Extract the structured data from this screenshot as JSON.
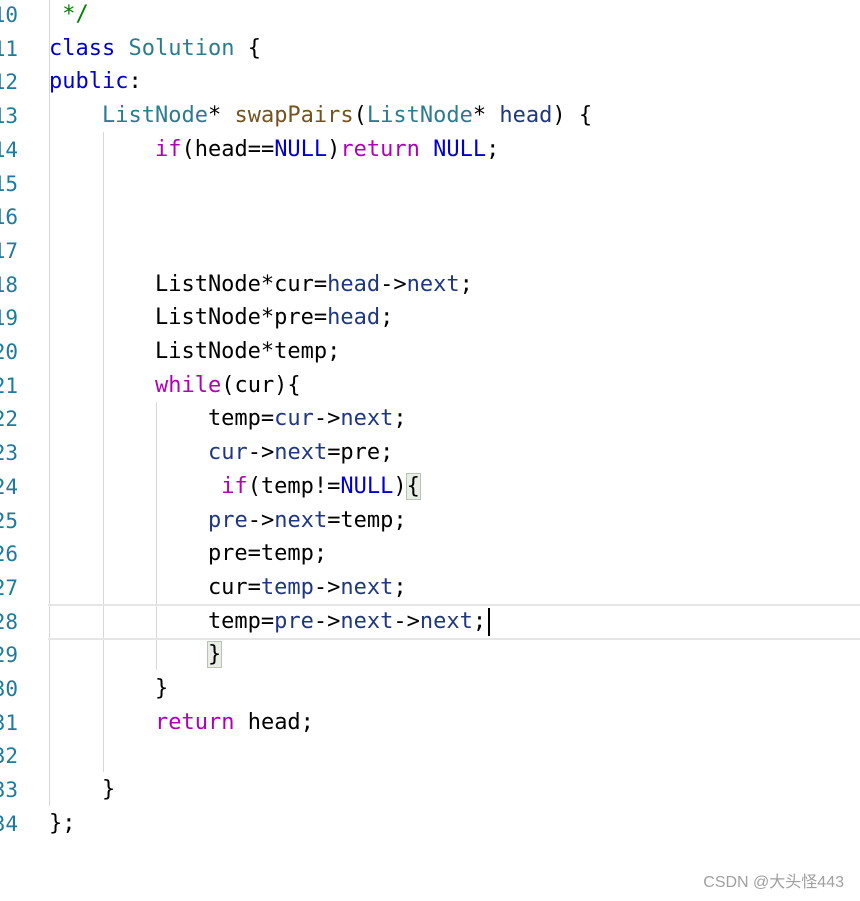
{
  "editor": {
    "language": "C++",
    "lines": [
      {
        "n": "10",
        "tokens": [
          {
            "t": " */",
            "c": "cm"
          }
        ]
      },
      {
        "n": "11",
        "tokens": [
          {
            "t": "class",
            "c": "kw"
          },
          {
            "t": " ",
            "c": "plain"
          },
          {
            "t": "Solution",
            "c": "ty"
          },
          {
            "t": " {",
            "c": "plain"
          }
        ]
      },
      {
        "n": "12",
        "tokens": [
          {
            "t": "public",
            "c": "kw"
          },
          {
            "t": ":",
            "c": "plain"
          }
        ]
      },
      {
        "n": "13",
        "tokens": [
          {
            "t": "    ",
            "c": "plain"
          },
          {
            "t": "ListNode",
            "c": "ty"
          },
          {
            "t": "* ",
            "c": "plain"
          },
          {
            "t": "swapPairs",
            "c": "fn"
          },
          {
            "t": "(",
            "c": "plain"
          },
          {
            "t": "ListNode",
            "c": "ty"
          },
          {
            "t": "* ",
            "c": "plain"
          },
          {
            "t": "head",
            "c": "var"
          },
          {
            "t": ") {",
            "c": "plain"
          }
        ]
      },
      {
        "n": "14",
        "tokens": [
          {
            "t": "        ",
            "c": "plain"
          },
          {
            "t": "if",
            "c": "kw2"
          },
          {
            "t": "(head==",
            "c": "plain"
          },
          {
            "t": "NULL",
            "c": "kw"
          },
          {
            "t": ")",
            "c": "plain"
          },
          {
            "t": "return",
            "c": "kw2"
          },
          {
            "t": " ",
            "c": "plain"
          },
          {
            "t": "NULL",
            "c": "kw"
          },
          {
            "t": ";",
            "c": "plain"
          }
        ]
      },
      {
        "n": "15",
        "tokens": []
      },
      {
        "n": "16",
        "tokens": []
      },
      {
        "n": "17",
        "tokens": []
      },
      {
        "n": "18",
        "tokens": [
          {
            "t": "        ListNode*cur=",
            "c": "plain"
          },
          {
            "t": "head",
            "c": "var"
          },
          {
            "t": "->",
            "c": "plain"
          },
          {
            "t": "next",
            "c": "var"
          },
          {
            "t": ";",
            "c": "plain"
          }
        ]
      },
      {
        "n": "19",
        "tokens": [
          {
            "t": "        ListNode*pre=",
            "c": "plain"
          },
          {
            "t": "head",
            "c": "var"
          },
          {
            "t": ";",
            "c": "plain"
          }
        ]
      },
      {
        "n": "20",
        "tokens": [
          {
            "t": "        ListNode*temp;",
            "c": "plain"
          }
        ]
      },
      {
        "n": "21",
        "tokens": [
          {
            "t": "        ",
            "c": "plain"
          },
          {
            "t": "while",
            "c": "kw2"
          },
          {
            "t": "(cur){",
            "c": "plain"
          }
        ]
      },
      {
        "n": "22",
        "tokens": [
          {
            "t": "            temp=",
            "c": "plain"
          },
          {
            "t": "cur",
            "c": "var"
          },
          {
            "t": "->",
            "c": "plain"
          },
          {
            "t": "next",
            "c": "var"
          },
          {
            "t": ";",
            "c": "plain"
          }
        ]
      },
      {
        "n": "23",
        "tokens": [
          {
            "t": "            ",
            "c": "plain"
          },
          {
            "t": "cur",
            "c": "var"
          },
          {
            "t": "->",
            "c": "plain"
          },
          {
            "t": "next",
            "c": "var"
          },
          {
            "t": "=pre;",
            "c": "plain"
          }
        ]
      },
      {
        "n": "24",
        "tokens": [
          {
            "t": "             ",
            "c": "plain"
          },
          {
            "t": "if",
            "c": "kw2"
          },
          {
            "t": "(temp!=",
            "c": "plain"
          },
          {
            "t": "NULL",
            "c": "kw"
          },
          {
            "t": ")",
            "c": "plain"
          },
          {
            "t": "{",
            "c": "match"
          }
        ]
      },
      {
        "n": "25",
        "tokens": [
          {
            "t": "            ",
            "c": "plain"
          },
          {
            "t": "pre",
            "c": "var"
          },
          {
            "t": "->",
            "c": "plain"
          },
          {
            "t": "next",
            "c": "var"
          },
          {
            "t": "=temp;",
            "c": "plain"
          }
        ]
      },
      {
        "n": "26",
        "tokens": [
          {
            "t": "            pre=temp;",
            "c": "plain"
          }
        ]
      },
      {
        "n": "27",
        "tokens": [
          {
            "t": "            cur=",
            "c": "plain"
          },
          {
            "t": "temp",
            "c": "var"
          },
          {
            "t": "->",
            "c": "plain"
          },
          {
            "t": "next",
            "c": "var"
          },
          {
            "t": ";",
            "c": "plain"
          }
        ]
      },
      {
        "n": "28",
        "tokens": [
          {
            "t": "            temp=",
            "c": "plain"
          },
          {
            "t": "pre",
            "c": "var"
          },
          {
            "t": "->",
            "c": "plain"
          },
          {
            "t": "next",
            "c": "var"
          },
          {
            "t": "->",
            "c": "plain"
          },
          {
            "t": "next",
            "c": "var"
          },
          {
            "t": ";",
            "c": "plain"
          }
        ],
        "caret": true
      },
      {
        "n": "29",
        "tokens": [
          {
            "t": "            ",
            "c": "plain"
          },
          {
            "t": "}",
            "c": "match"
          }
        ]
      },
      {
        "n": "30",
        "tokens": [
          {
            "t": "        }",
            "c": "plain"
          }
        ]
      },
      {
        "n": "31",
        "tokens": [
          {
            "t": "        ",
            "c": "plain"
          },
          {
            "t": "return",
            "c": "kw2"
          },
          {
            "t": " head;",
            "c": "plain"
          }
        ]
      },
      {
        "n": "32",
        "tokens": []
      },
      {
        "n": "33",
        "tokens": [
          {
            "t": "    }",
            "c": "plain"
          }
        ]
      },
      {
        "n": "34",
        "tokens": [
          {
            "t": "};",
            "c": "plain"
          }
        ]
      }
    ]
  },
  "watermark": "CSDN @大头怪443",
  "colors": {
    "keyword": "#0000d0",
    "control": "#b000b8",
    "type": "#2b7c8f",
    "function": "#74531f",
    "variable": "#1f377f",
    "comment": "#008000",
    "line_number": "#1f7a9b"
  }
}
